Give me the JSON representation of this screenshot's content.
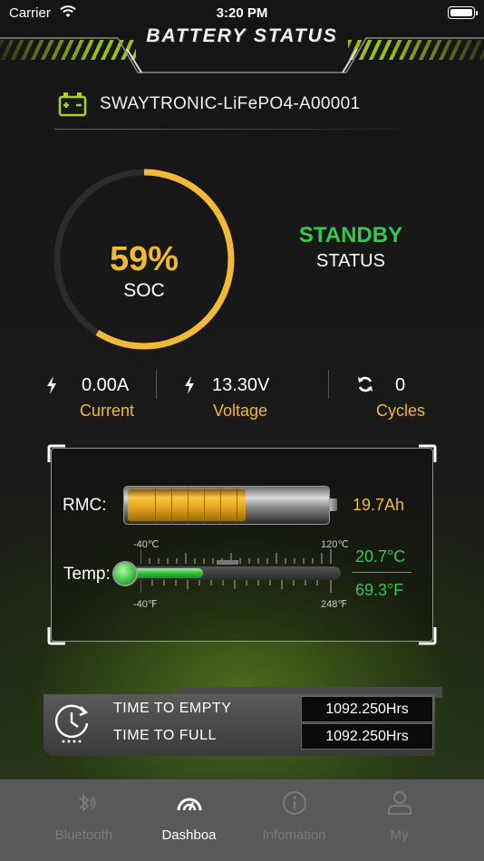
{
  "status_bar": {
    "carrier": "Carrier",
    "time": "3:20 PM"
  },
  "header": {
    "title": "BATTERY STATUS"
  },
  "device": {
    "name": "SWAYTRONIC-LiFePO4-A00001",
    "icon": "battery-icon"
  },
  "soc": {
    "value": "59%",
    "label": "SOC",
    "fraction": 0.59
  },
  "state": {
    "value": "STANDBY",
    "label": "STATUS"
  },
  "stats": [
    {
      "icon": "lightning-icon",
      "value": "0.00A",
      "label": "Current"
    },
    {
      "icon": "lightning-icon",
      "value": "13.30V",
      "label": "Voltage"
    },
    {
      "icon": "cycle-icon",
      "value": "0",
      "label": "Cycles"
    }
  ],
  "rmc": {
    "label": "RMC:",
    "value": "19.7Ah",
    "fill_fraction": 0.59
  },
  "temp": {
    "label": "Temp:",
    "celsius": "20.7°C",
    "fahrenheit": "69.3°F",
    "scale_c_min": "-40℃",
    "scale_c_max": "120℃",
    "scale_f_min": "-40℉",
    "scale_f_max": "248℉",
    "fill_fraction": 0.38
  },
  "time": {
    "empty_label": "TIME TO EMPTY",
    "empty_value": "1092.250Hrs",
    "full_label": "TIME TO FULL",
    "full_value": "1092.250Hrs"
  },
  "tabs": [
    {
      "label": "Bluetooth",
      "icon": "bluetooth-icon",
      "active": false
    },
    {
      "label": "Dashboa",
      "icon": "dashboard-icon",
      "active": true
    },
    {
      "label": "Infomation",
      "icon": "info-icon",
      "active": false
    },
    {
      "label": "My",
      "icon": "user-icon",
      "active": false
    }
  ],
  "colors": {
    "accent": "#f2b937",
    "green": "#37c94b",
    "lime": "#a6d41f"
  }
}
